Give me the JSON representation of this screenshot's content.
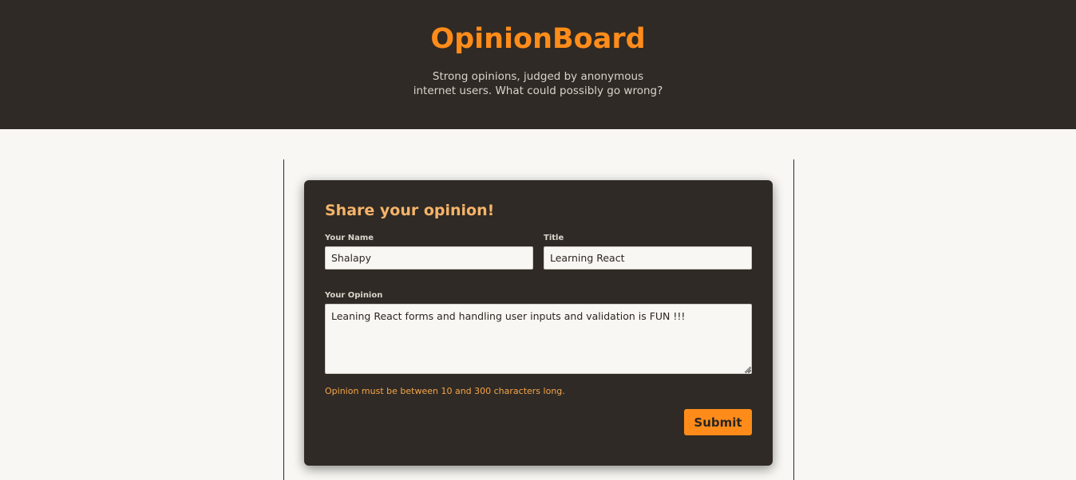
{
  "header": {
    "brand": "OpinionBoard",
    "tagline": "Strong opinions, judged by anonymous internet users. What could possibly go wrong?"
  },
  "form": {
    "title": "Share your opinion!",
    "name_label": "Your Name",
    "name_value": "Shalapy",
    "title_label": "Title",
    "title_value": "Learning React",
    "opinion_label": "Your Opinion",
    "opinion_value": "Leaning React forms and handling user inputs and validation is FUN !!!",
    "error_message": "Opinion must be between 10 and 300 characters long.",
    "submit_label": "Submit"
  },
  "colors": {
    "header_bg": "#2f2a25",
    "accent": "#ff8c1a",
    "page_bg": "#f8f7f3",
    "error": "#f6a54a"
  }
}
